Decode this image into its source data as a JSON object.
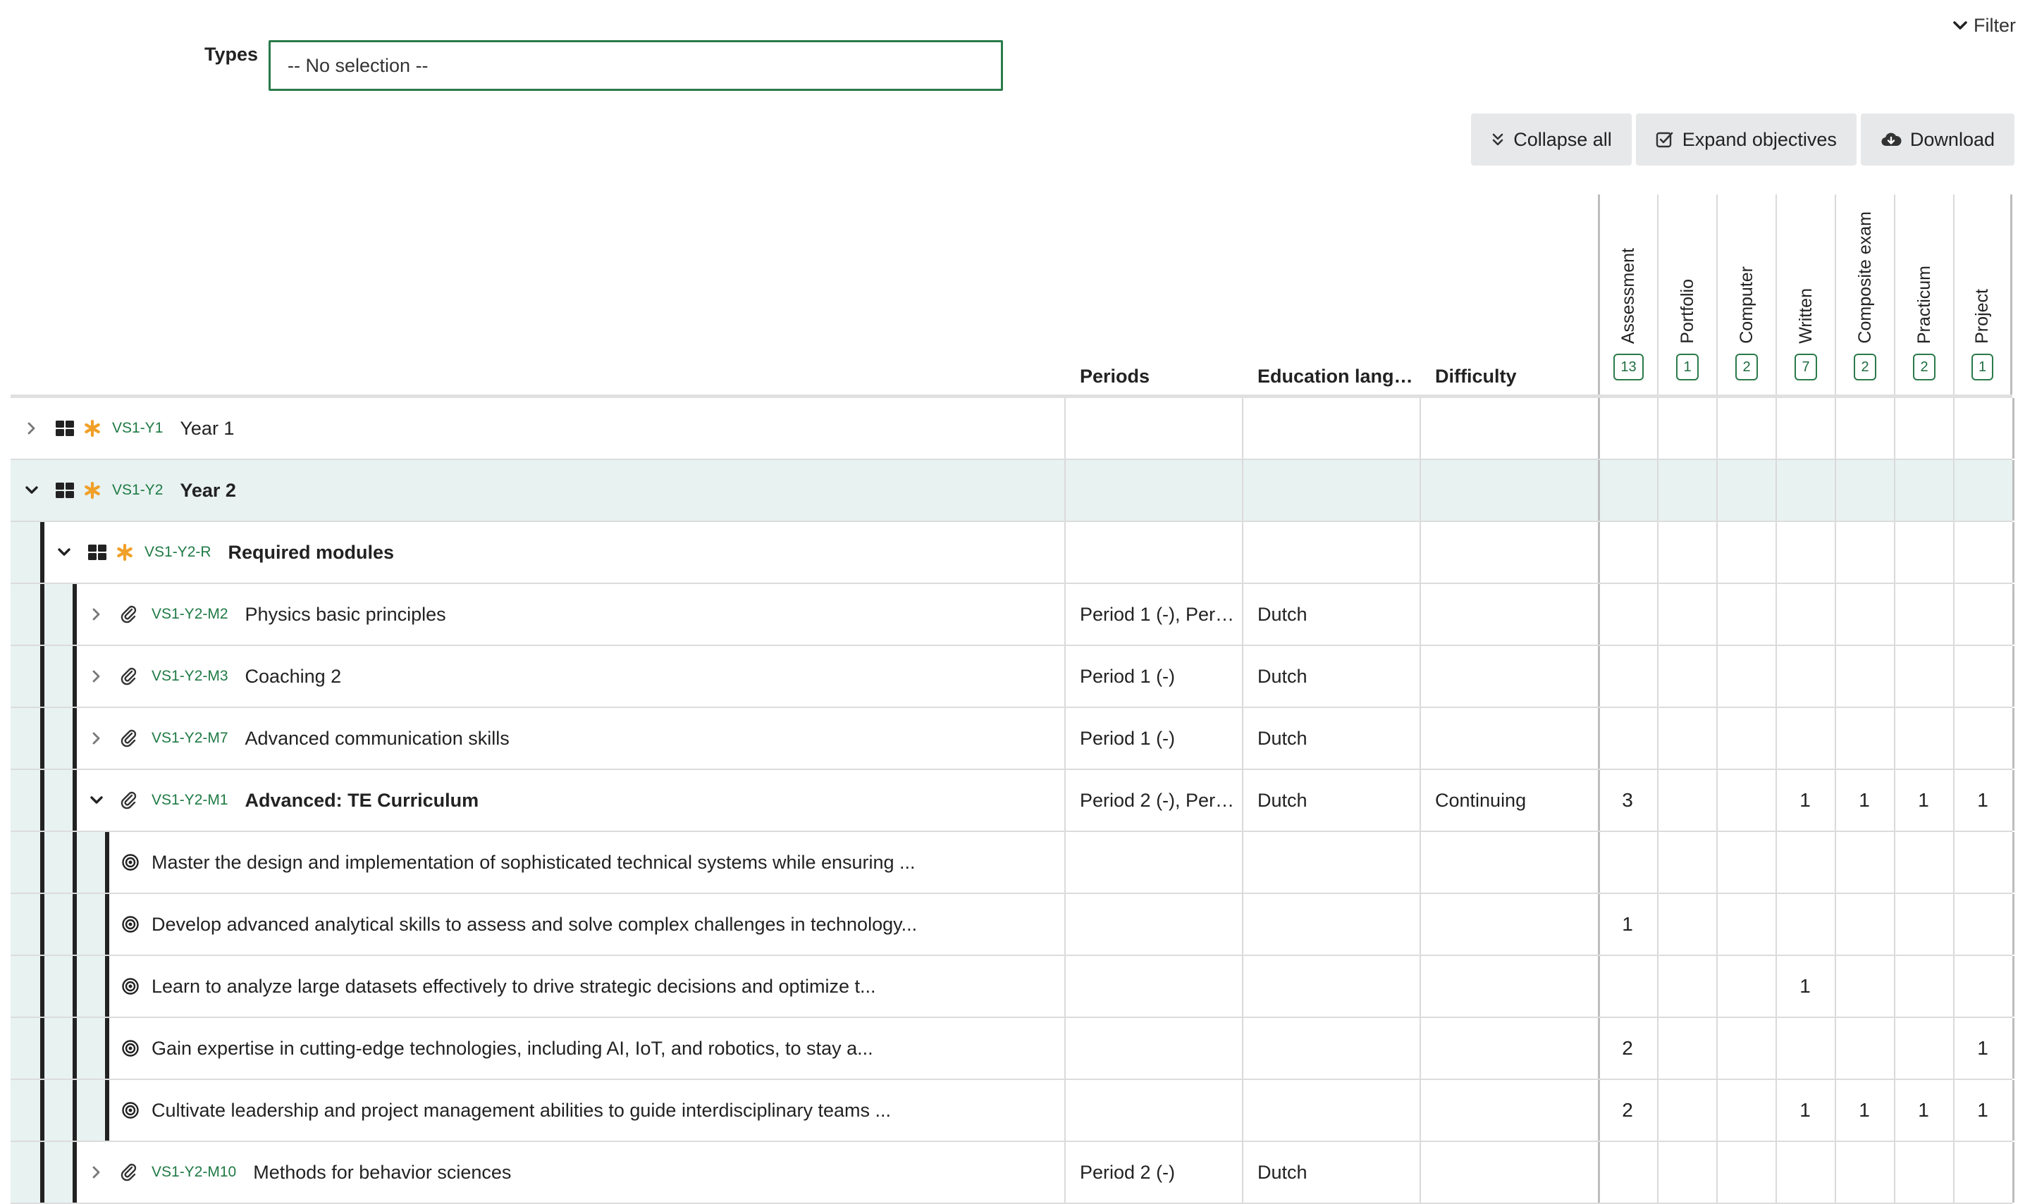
{
  "filter": {
    "label": "Filter"
  },
  "types": {
    "label": "Types",
    "value": "-- No selection --"
  },
  "toolbar": {
    "collapse_all": "Collapse all",
    "expand_objectives": "Expand objectives",
    "download": "Download"
  },
  "columns": {
    "periods": "Periods",
    "language": "Education lang…",
    "difficulty": "Difficulty"
  },
  "type_columns": [
    {
      "name": "Assessment",
      "count": "13"
    },
    {
      "name": "Portfolio",
      "count": "1"
    },
    {
      "name": "Computer",
      "count": "2"
    },
    {
      "name": "Written",
      "count": "7"
    },
    {
      "name": "Composite exam",
      "count": "2"
    },
    {
      "name": "Practicum",
      "count": "2"
    },
    {
      "name": "Project",
      "count": "1"
    }
  ],
  "rows": [
    {
      "kind": "group",
      "level": 0,
      "expanded": false,
      "code": "VS1-Y1",
      "name": "Year 1",
      "bold": false,
      "highlight": false,
      "periods": "",
      "language": "",
      "difficulty": "",
      "values": [
        "",
        "",
        "",
        "",
        "",
        "",
        ""
      ]
    },
    {
      "kind": "group",
      "level": 0,
      "expanded": true,
      "code": "VS1-Y2",
      "name": "Year 2",
      "bold": true,
      "highlight": true,
      "periods": "",
      "language": "",
      "difficulty": "",
      "values": [
        "",
        "",
        "",
        "",
        "",
        "",
        ""
      ]
    },
    {
      "kind": "group",
      "level": 1,
      "expanded": true,
      "code": "VS1-Y2-R",
      "name": "Required modules",
      "bold": true,
      "highlight": false,
      "periods": "",
      "language": "",
      "difficulty": "",
      "values": [
        "",
        "",
        "",
        "",
        "",
        "",
        ""
      ]
    },
    {
      "kind": "module",
      "level": 2,
      "expanded": false,
      "code": "VS1-Y2-M2",
      "name": "Physics basic principles",
      "bold": false,
      "highlight": false,
      "periods": "Period 1 (-), Per…",
      "language": "Dutch",
      "difficulty": "",
      "values": [
        "",
        "",
        "",
        "",
        "",
        "",
        ""
      ]
    },
    {
      "kind": "module",
      "level": 2,
      "expanded": false,
      "code": "VS1-Y2-M3",
      "name": "Coaching 2",
      "bold": false,
      "highlight": false,
      "periods": "Period 1 (-)",
      "language": "Dutch",
      "difficulty": "",
      "values": [
        "",
        "",
        "",
        "",
        "",
        "",
        ""
      ]
    },
    {
      "kind": "module",
      "level": 2,
      "expanded": false,
      "code": "VS1-Y2-M7",
      "name": "Advanced communication skills",
      "bold": false,
      "highlight": false,
      "periods": "Period 1 (-)",
      "language": "Dutch",
      "difficulty": "",
      "values": [
        "",
        "",
        "",
        "",
        "",
        "",
        ""
      ]
    },
    {
      "kind": "module",
      "level": 2,
      "expanded": true,
      "code": "VS1-Y2-M1",
      "name": "Advanced: TE Curriculum",
      "bold": true,
      "highlight": false,
      "periods": "Period 2 (-), Per…",
      "language": "Dutch",
      "difficulty": "Continuing",
      "values": [
        "3",
        "",
        "",
        "1",
        "1",
        "1",
        "1"
      ]
    },
    {
      "kind": "objective",
      "level": 3,
      "name": "Master the design and implementation of sophisticated technical systems while ensuring ...",
      "periods": "",
      "language": "",
      "difficulty": "",
      "values": [
        "",
        "",
        "",
        "",
        "",
        "",
        ""
      ]
    },
    {
      "kind": "objective",
      "level": 3,
      "name": "Develop advanced analytical skills to assess and solve complex challenges in technology...",
      "periods": "",
      "language": "",
      "difficulty": "",
      "values": [
        "1",
        "",
        "",
        "",
        "",
        "",
        ""
      ]
    },
    {
      "kind": "objective",
      "level": 3,
      "name": "Learn to analyze large datasets effectively to drive strategic decisions and optimize t...",
      "periods": "",
      "language": "",
      "difficulty": "",
      "values": [
        "",
        "",
        "",
        "1",
        "",
        "",
        ""
      ]
    },
    {
      "kind": "objective",
      "level": 3,
      "name": "Gain expertise in cutting-edge technologies, including AI, IoT, and robotics, to stay a...",
      "periods": "",
      "language": "",
      "difficulty": "",
      "values": [
        "2",
        "",
        "",
        "",
        "",
        "",
        "1"
      ]
    },
    {
      "kind": "objective",
      "level": 3,
      "name": "Cultivate leadership and project management abilities to guide interdisciplinary teams ...",
      "periods": "",
      "language": "",
      "difficulty": "",
      "values": [
        "2",
        "",
        "",
        "1",
        "1",
        "1",
        "1"
      ]
    },
    {
      "kind": "module",
      "level": 2,
      "expanded": false,
      "code": "VS1-Y2-M10",
      "name": "Methods for behavior sciences",
      "bold": false,
      "highlight": false,
      "periods": "Period 2 (-)",
      "language": "Dutch",
      "difficulty": "",
      "values": [
        "",
        "",
        "",
        "",
        "",
        "",
        ""
      ]
    }
  ]
}
